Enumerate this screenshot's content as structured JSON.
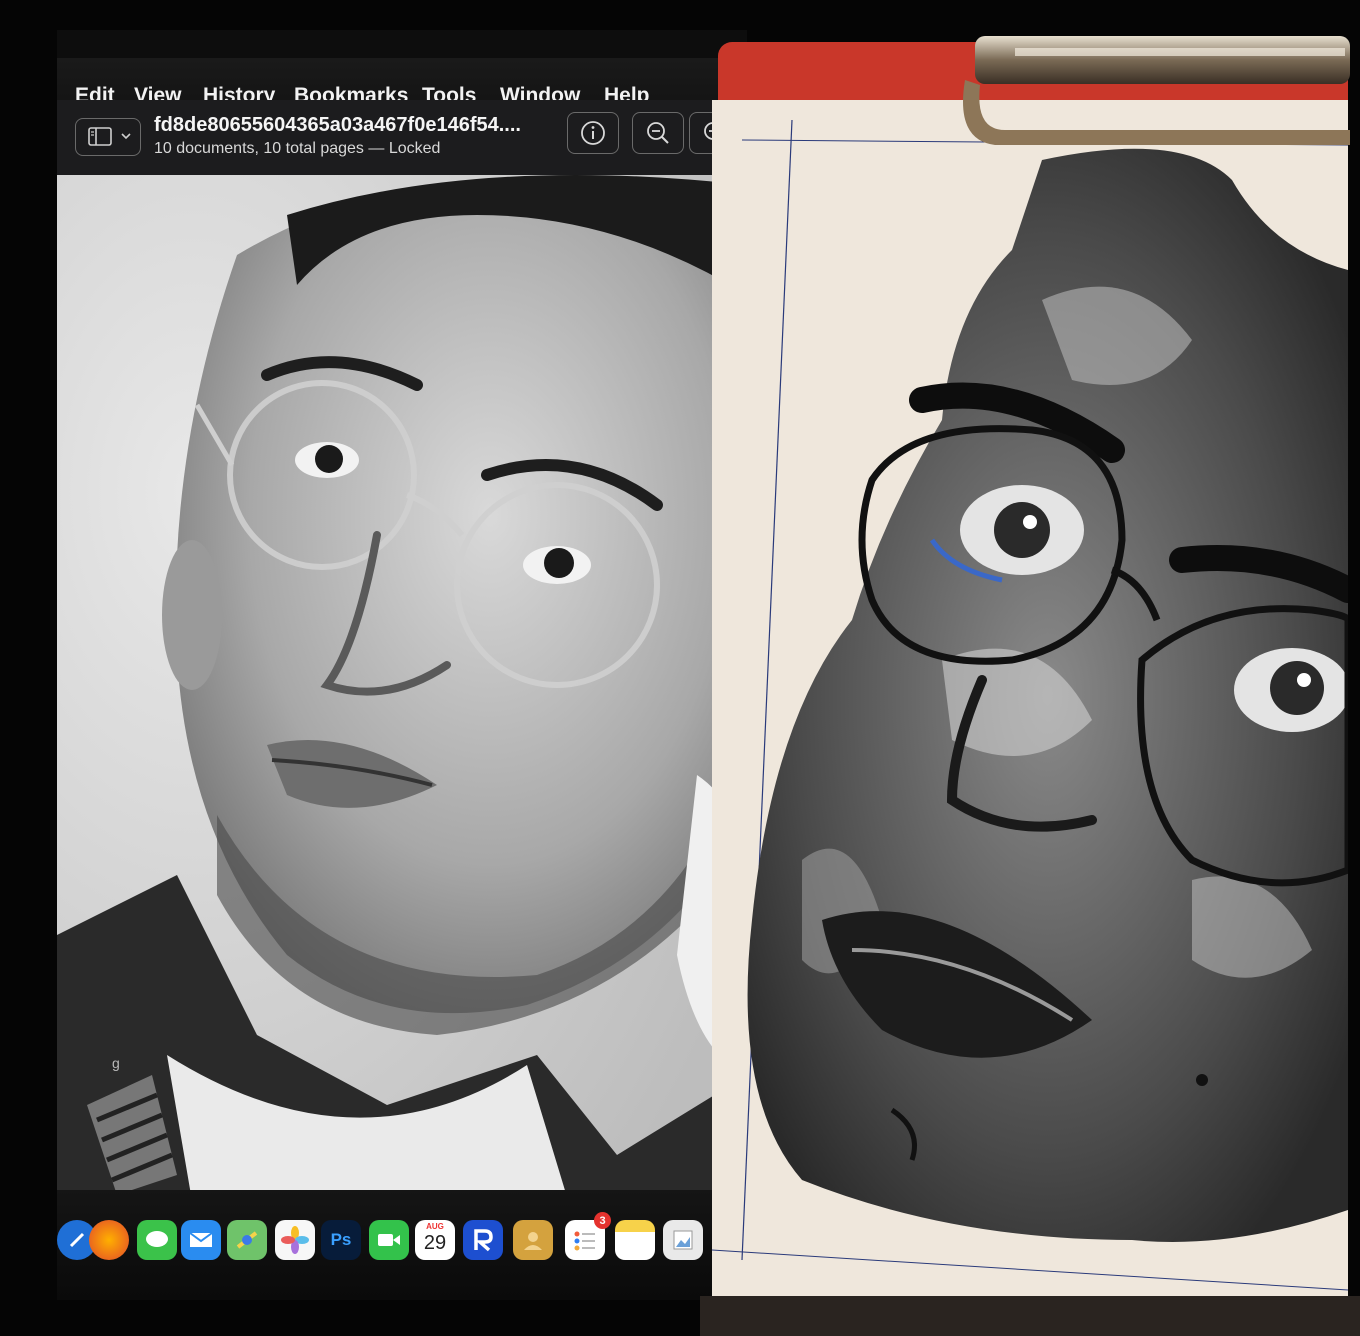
{
  "menubar": {
    "items": [
      "Edit",
      "View",
      "History",
      "Bookmarks",
      "Tools",
      "Window",
      "Help"
    ]
  },
  "document": {
    "title": "fd8de80655604365a03a467f0e146f54....",
    "subtitle": "10 documents, 10 total pages — Locked"
  },
  "toolbar": {
    "icons": [
      "sidebar-toggle-icon",
      "info-icon",
      "zoom-out-icon",
      "zoom-in-icon"
    ]
  },
  "dock": {
    "apps": [
      "safari",
      "firefox",
      "messages",
      "mail",
      "maps",
      "photos",
      "photoshop",
      "facetime",
      "calendar",
      "remote",
      "contacts",
      "reminders",
      "notes",
      "preview"
    ],
    "photoshop_label": "Ps",
    "calendar_month": "AUG",
    "calendar_day": "29",
    "reminders_badge": "3"
  },
  "side_glyph": "g",
  "scene": {
    "left": "vintage black-and-white portrait photo on monitor",
    "right": "charcoal pencil portrait drawing on red clipboard"
  }
}
